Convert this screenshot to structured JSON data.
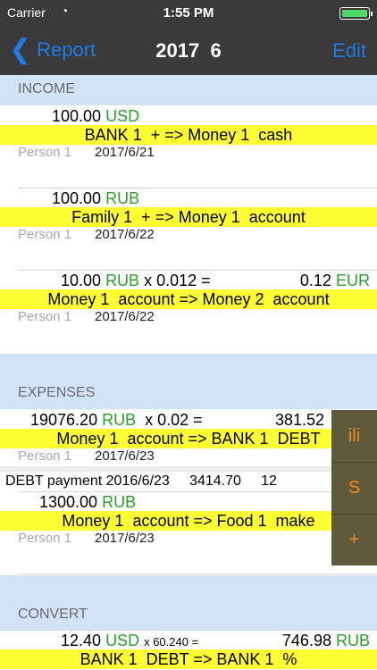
{
  "status": {
    "carrier": "Carrier",
    "time": "1:55 PM"
  },
  "nav": {
    "back_label": "Report",
    "title": "2017  6",
    "edit_label": "Edit"
  },
  "sections": {
    "income": "INCOME",
    "expenses": "EXPENSES",
    "convert": "CONVERT"
  },
  "income": [
    {
      "amount": "100.00",
      "currency": "USD",
      "transfer": "BANK 1  + => Money 1  cash",
      "person": "Person 1",
      "date": "2017/6/21"
    },
    {
      "amount": "100.00",
      "currency": "RUB",
      "transfer": "Family 1  + => Money 1  account",
      "person": "Person 1",
      "date": "2017/6/22"
    },
    {
      "amount": "10.00",
      "currency": "RUB",
      "rate": "x 0.012 =",
      "converted": "0.12",
      "converted_currency": "EUR",
      "transfer": "Money 1  account => Money 2  account",
      "person": "Person 1",
      "date": "2017/6/22"
    }
  ],
  "expenses": [
    {
      "amount": "19076.20",
      "currency": "RUB",
      "rate": "x 0.02 =",
      "converted": "381.52",
      "transfer": "Money 1  account => BANK 1  DEBT",
      "person": "Person 1",
      "date": "2017/6/23",
      "debt_line": "DEBT payment 2016/6/23     3414.70     12"
    },
    {
      "amount": "1300.00",
      "currency": "RUB",
      "transfer": "Money 1  account => Food 1  make",
      "person": "Person 1",
      "date": "2017/6/23"
    }
  ],
  "convert": [
    {
      "amount": "12.40",
      "currency": "USD",
      "rate": "x 60.240 =",
      "converted": "746.98",
      "converted_currency": "RUB",
      "transfer": "BANK 1  DEBT => BANK 1  %"
    }
  ],
  "side_buttons": [
    "ili",
    "S",
    "+"
  ],
  "colors": {
    "nav_bg": "#3a3a3a",
    "accent_blue": "#1e7be8",
    "currency_green": "#2aa02a",
    "highlight_yellow": "#ffff33",
    "section_bg": "#d3e3f7",
    "side_panel": "#5f5a3c",
    "side_text": "#f08a1c"
  }
}
